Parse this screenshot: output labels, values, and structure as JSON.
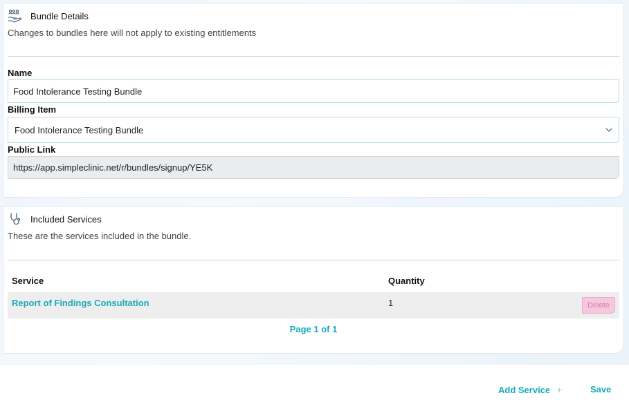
{
  "bundle_details": {
    "title": "Bundle Details",
    "subtitle": "Changes to bundles here will not apply to existing entitlements",
    "icon": "hand-holding-people-icon",
    "name_label": "Name",
    "name_value": "Food Intolerance Testing Bundle",
    "billing_label": "Billing Item",
    "billing_value": "Food Intolerance Testing Bundle",
    "public_link_label": "Public Link",
    "public_link_value": "https://app.simpleclinic.net/r/bundles/signup/YE5K"
  },
  "included_services": {
    "title": "Included Services",
    "subtitle": "These are the services included in the bundle.",
    "icon": "stethoscope-icon",
    "columns": [
      "Service",
      "Quantity"
    ],
    "rows": [
      {
        "service": "Report of Findings Consultation",
        "quantity": "1",
        "action": "Delete"
      }
    ],
    "pager": "Page 1 of 1"
  },
  "footer": {
    "add_service_label": "Add Service",
    "save_label": "Save"
  },
  "colors": {
    "accent": "#1aa9b8",
    "delete_bg": "#f5c8de",
    "delete_text": "#d77aaa"
  }
}
